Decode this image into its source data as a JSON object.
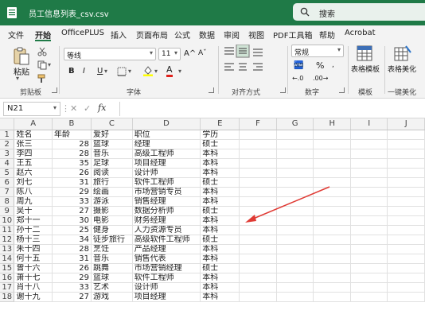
{
  "window": {
    "title": "员工信息列表_csv.csv",
    "search_placeholder": "搜索"
  },
  "menu": {
    "tabs": [
      "文件",
      "开始",
      "OfficePLUS",
      "插入",
      "页面布局",
      "公式",
      "数据",
      "审阅",
      "视图",
      "PDF工具箱",
      "帮助",
      "Acrobat"
    ],
    "active_index": 1
  },
  "ribbon": {
    "paste_label": "粘贴",
    "font_name": "等线",
    "font_size": "11",
    "number_format": "常规",
    "number_currency": "%",
    "group_labels": {
      "clipboard": "剪贴板",
      "font": "字体",
      "alignment": "对齐方式",
      "number": "数字",
      "template": "模板",
      "beautify": "一键美化"
    },
    "table_template_label": "表格模板",
    "table_beautify_label": "表格美化",
    "bold": "B",
    "italic": "I",
    "underline": "U",
    "font_color_glyph": "A",
    "grow_font": "A",
    "font_letters_grow": "A^",
    "font_letters_shrink": "Aˇ",
    "num_decimal_increase": "←.0",
    "num_decimal_decrease": ".00→"
  },
  "formula_bar": {
    "name_box": "N21",
    "formula": ""
  },
  "sheet": {
    "columns": [
      "A",
      "B",
      "C",
      "D",
      "E",
      "F",
      "G",
      "H",
      "I",
      "J"
    ],
    "rows": [
      [
        "姓名",
        "年龄",
        "爱好",
        "职位",
        "学历"
      ],
      [
        "张三",
        "28",
        "篮球",
        "经理",
        "硕士"
      ],
      [
        "李四",
        "28",
        "音乐",
        "高级工程师",
        "本科"
      ],
      [
        "王五",
        "35",
        "足球",
        "项目经理",
        "本科"
      ],
      [
        "赵六",
        "26",
        "阅读",
        "设计师",
        "本科"
      ],
      [
        "刘七",
        "31",
        "旅行",
        "软件工程师",
        "硕士"
      ],
      [
        "陈八",
        "29",
        "绘画",
        "市场营销专员",
        "本科"
      ],
      [
        "周九",
        "33",
        "游泳",
        "销售经理",
        "本科"
      ],
      [
        "吴十",
        "27",
        "摄影",
        "数据分析师",
        "硕士"
      ],
      [
        "郑十一",
        "30",
        "电影",
        "财务经理",
        "本科"
      ],
      [
        "孙十二",
        "25",
        "健身",
        "人力资源专员",
        "本科"
      ],
      [
        "杨十三",
        "34",
        "徒步旅行",
        "高级软件工程师",
        "硕士"
      ],
      [
        "朱十四",
        "28",
        "烹饪",
        "产品经理",
        "本科"
      ],
      [
        "何十五",
        "31",
        "音乐",
        "销售代表",
        "本科"
      ],
      [
        "曾十六",
        "26",
        "跳舞",
        "市场营销经理",
        "硕士"
      ],
      [
        "萧十七",
        "29",
        "篮球",
        "软件工程师",
        "本科"
      ],
      [
        "肖十八",
        "33",
        "艺术",
        "设计师",
        "本科"
      ],
      [
        "谢十九",
        "27",
        "游戏",
        "项目经理",
        "本科"
      ]
    ]
  },
  "colors": {
    "accent": "#1f7a47",
    "arrow": "#e03a34"
  }
}
